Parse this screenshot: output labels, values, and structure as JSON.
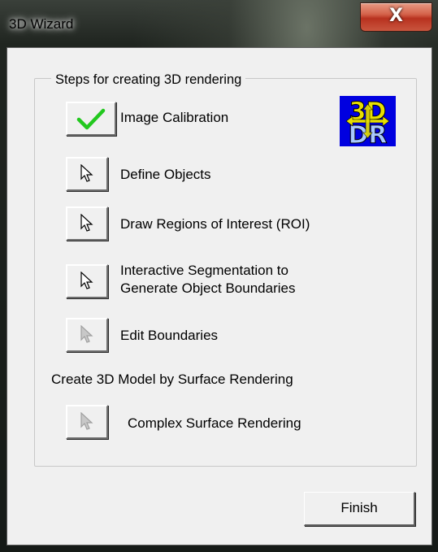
{
  "window": {
    "title": "3D Wizard",
    "close_glyph": "X"
  },
  "groupbox": {
    "legend": "Steps for creating 3D rendering"
  },
  "steps": [
    {
      "label": "Image Calibration",
      "icon": "checkmark-icon",
      "enabled": true
    },
    {
      "label": "Define Objects",
      "icon": "pointer-arrow-icon",
      "enabled": true
    },
    {
      "label": "Draw Regions of Interest (ROI)",
      "icon": "pointer-arrow-icon",
      "enabled": true
    },
    {
      "label_line1": "Interactive Segmentation to",
      "label_line2": "Generate Object Boundaries",
      "icon": "pointer-arrow-icon",
      "enabled": true
    },
    {
      "label": "Edit Boundaries",
      "icon": "pointer-arrow-icon",
      "enabled": false
    }
  ],
  "surface_section": {
    "heading": "Create 3D Model by Surface Rendering",
    "step": {
      "label": "Complex Surface Rendering",
      "icon": "pointer-arrow-icon",
      "enabled": false
    }
  },
  "logo": {
    "icon": "3d-dr-logo-icon",
    "text_top": "3D",
    "text_bottom": "DR"
  },
  "footer": {
    "finish_label": "Finish"
  },
  "colors": {
    "check_green": "#22c81e",
    "logo_blue": "#0000e0",
    "logo_yellow": "#e8e000",
    "close_red": "#c74530"
  }
}
